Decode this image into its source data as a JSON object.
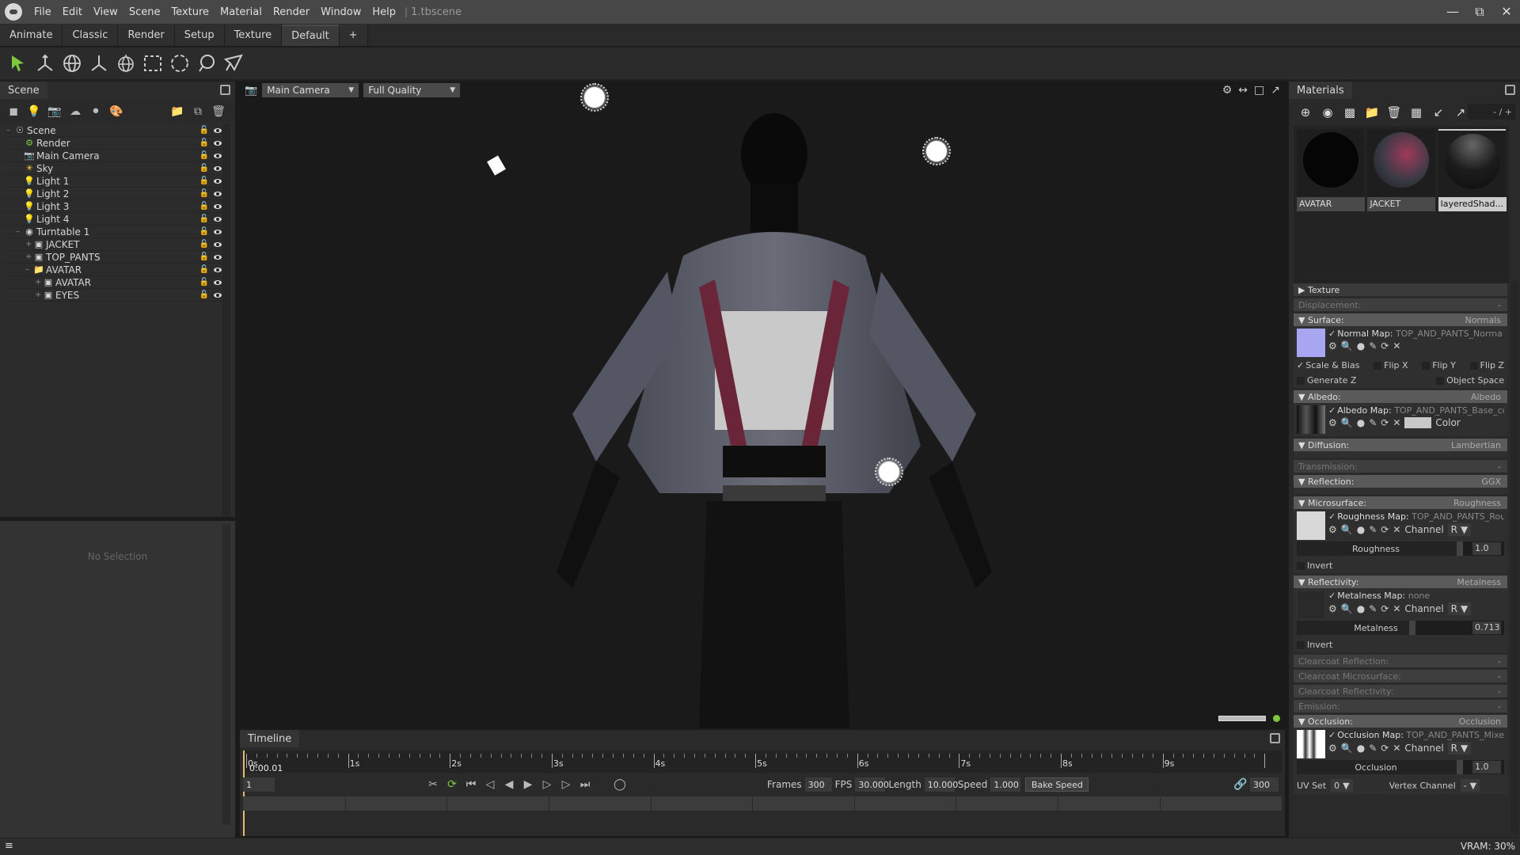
{
  "titlebar": {
    "menus": [
      "File",
      "Edit",
      "View",
      "Scene",
      "Texture",
      "Material",
      "Render",
      "Window",
      "Help"
    ],
    "document": "1.tbscene",
    "window_buttons": [
      "minimize",
      "restore",
      "close"
    ]
  },
  "workspace_tabs": [
    "Animate",
    "Classic",
    "Render",
    "Setup",
    "Texture",
    "Default",
    "+"
  ],
  "active_workspace": "Default",
  "toolbar": {
    "tools": [
      "select-arrow",
      "transform",
      "rotate-sphere",
      "axis-transform",
      "scale-sphere",
      "rect-select",
      "circle-select",
      "lasso-select",
      "polygon-select"
    ],
    "active_tool": "select-arrow"
  },
  "scene_panel": {
    "tab": "Scene",
    "tree": [
      {
        "label": "Scene",
        "depth": 0,
        "icon": "scene"
      },
      {
        "label": "Render",
        "depth": 1,
        "icon": "render"
      },
      {
        "label": "Main Camera",
        "depth": 1,
        "icon": "camera"
      },
      {
        "label": "Sky",
        "depth": 1,
        "icon": "sky"
      },
      {
        "label": "Light 1",
        "depth": 1,
        "icon": "light"
      },
      {
        "label": "Light 2",
        "depth": 1,
        "icon": "light"
      },
      {
        "label": "Light 3",
        "depth": 1,
        "icon": "light"
      },
      {
        "label": "Light 4",
        "depth": 1,
        "icon": "light"
      },
      {
        "label": "Turntable 1",
        "depth": 1,
        "icon": "turntable"
      },
      {
        "label": "JACKET",
        "depth": 2,
        "icon": "mesh"
      },
      {
        "label": "TOP_PANTS",
        "depth": 2,
        "icon": "mesh"
      },
      {
        "label": "AVATAR",
        "depth": 2,
        "icon": "folder"
      },
      {
        "label": "AVATAR",
        "depth": 3,
        "icon": "mesh"
      },
      {
        "label": "EYES",
        "depth": 3,
        "icon": "mesh"
      }
    ]
  },
  "properties_panel": {
    "empty_text": "No Selection"
  },
  "viewport": {
    "camera": "Main Camera",
    "quality": "Full Quality"
  },
  "timeline": {
    "tab": "Timeline",
    "current_time": "0:00.01",
    "second_labels": [
      "0s",
      "1s",
      "2s",
      "3s",
      "4s",
      "5s",
      "6s",
      "7s",
      "8s",
      "9s"
    ],
    "current_frame": "1",
    "frames_label": "Frames",
    "frames": "300",
    "fps_label": "FPS",
    "fps": "30.000",
    "length_label": "Length",
    "length": "10.000",
    "speed_label": "Speed",
    "speed": "1.000",
    "bake_speed": "Bake Speed",
    "end_frame": "300"
  },
  "materials": {
    "tab": "Materials",
    "counter": "- / +",
    "items": [
      {
        "name": "AVATAR",
        "selected": false
      },
      {
        "name": "JACKET",
        "selected": false
      },
      {
        "name": "layeredShad...",
        "selected": true
      }
    ],
    "texture_label": "Texture",
    "displacement": {
      "label": "Displacement:",
      "value": "-"
    },
    "surface": {
      "label": "Surface:",
      "value": "Normals",
      "map_label": "Normal Map:",
      "map_file": "TOP_AND_PANTS_Norma",
      "options": [
        {
          "label": "Scale & Bias",
          "checked": true
        },
        {
          "label": "Flip X",
          "checked": false
        },
        {
          "label": "Flip Y",
          "checked": false
        },
        {
          "label": "Flip Z",
          "checked": false
        },
        {
          "label": "Generate Z",
          "checked": false
        },
        {
          "label": "Object Space",
          "checked": false
        }
      ]
    },
    "albedo": {
      "label": "Albedo:",
      "value": "Albedo",
      "map_label": "Albedo Map:",
      "map_file": "TOP_AND_PANTS_Base_co",
      "color_label": "Color",
      "color": "#c8c8c8"
    },
    "diffusion": {
      "label": "Diffusion:",
      "value": "Lambertian"
    },
    "transmission": {
      "label": "Transmission:",
      "value": "-"
    },
    "reflection": {
      "label": "Reflection:",
      "value": "GGX"
    },
    "microsurface": {
      "label": "Microsurface:",
      "value": "Roughness",
      "map_label": "Roughness Map:",
      "map_file": "TOP_AND_PANTS_Rou",
      "channel_label": "Channel",
      "channel": "R",
      "slider_label": "Roughness",
      "slider_value": "1.0",
      "slider_fraction": 1.0,
      "invert_label": "Invert"
    },
    "reflectivity": {
      "label": "Reflectivity:",
      "value": "Metalness",
      "map_label": "Metalness Map:",
      "map_file": "none",
      "channel_label": "Channel",
      "channel": "R",
      "slider_label": "Metalness",
      "slider_value": "0.713",
      "slider_fraction": 0.713,
      "invert_label": "Invert"
    },
    "clearcoat_reflection": {
      "label": "Clearcoat Reflection:",
      "value": "-"
    },
    "clearcoat_microsurface": {
      "label": "Clearcoat Microsurface:",
      "value": "-"
    },
    "clearcoat_reflectivity": {
      "label": "Clearcoat Reflectivity:",
      "value": "-"
    },
    "emission": {
      "label": "Emission:",
      "value": "-"
    },
    "occlusion": {
      "label": "Occlusion:",
      "value": "Occlusion",
      "map_label": "Occlusion Map:",
      "map_file": "TOP_AND_PANTS_Mixe",
      "channel_label": "Channel",
      "channel": "R",
      "slider_label": "Occlusion",
      "slider_value": "1.0",
      "slider_fraction": 1.0,
      "uvset_label": "UV Set",
      "uvset": "0",
      "vertex_label": "Vertex Channel",
      "vertex": "-"
    }
  },
  "status": {
    "vram": "VRAM: 30%"
  },
  "colors": {
    "accent_green": "#7dc83c",
    "playhead": "#e0c070",
    "background": "#1b1b1b"
  }
}
